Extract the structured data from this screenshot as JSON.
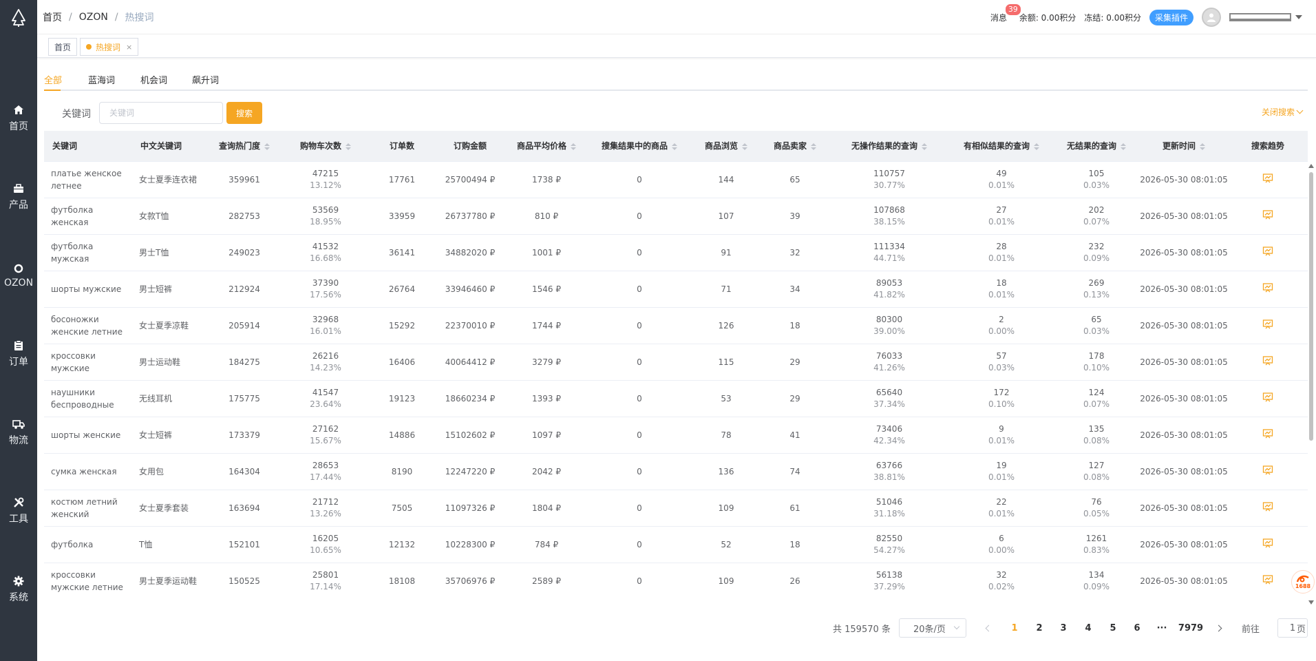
{
  "sidebar": {
    "logo_icon": "tree-logo-icon",
    "items": [
      {
        "label": "首页",
        "icon": "home-icon"
      },
      {
        "label": "产品",
        "icon": "briefcase-icon"
      },
      {
        "label": "OZON",
        "icon": "ozon-ring-icon"
      },
      {
        "label": "订单",
        "icon": "clipboard-icon"
      },
      {
        "label": "物流",
        "icon": "truck-icon"
      },
      {
        "label": "工具",
        "icon": "tools-icon"
      },
      {
        "label": "系统",
        "icon": "gear-icon"
      }
    ]
  },
  "header": {
    "breadcrumb": [
      "首页",
      "OZON",
      "热搜词"
    ],
    "messages_label": "消息",
    "messages_count": "39",
    "balance": "余额: 0.00积分",
    "frozen": "冻结: 0.00积分",
    "plugin_button": "采集插件"
  },
  "tags": [
    {
      "label": "首页"
    },
    {
      "label": "热搜词",
      "close": "×"
    }
  ],
  "tabs": [
    "全部",
    "蓝海词",
    "机会词",
    "飙升词"
  ],
  "search": {
    "label": "关键词",
    "placeholder": "关键词",
    "button": "搜索",
    "close_label": "关闭搜索"
  },
  "table": {
    "columns": [
      "关键词",
      "中文关键词",
      "查询热门度",
      "购物车次数",
      "订单数",
      "订购金额",
      "商品平均价格",
      "搜集结果中的商品",
      "商品浏览",
      "商品卖家",
      "无操作结果的查询",
      "有相似结果的查询",
      "无结果的查询",
      "更新时间",
      "搜索趋势"
    ],
    "rows": [
      {
        "kw": "платье женское летнее",
        "cn": "女士夏季连衣裙",
        "hot": "359961",
        "cart": "47215",
        "cart_pct": "13.12%",
        "orders": "17761",
        "amount": "25700494 ₽",
        "avg": "1738 ₽",
        "results": "0",
        "views": "144",
        "sellers": "65",
        "noop": "110757",
        "noop_pct": "30.77%",
        "similar": "49",
        "similar_pct": "0.01%",
        "none": "105",
        "none_pct": "0.03%",
        "updated": "2026-05-30 08:01:05"
      },
      {
        "kw": "футболка женская",
        "cn": "女款T恤",
        "hot": "282753",
        "cart": "53569",
        "cart_pct": "18.95%",
        "orders": "33959",
        "amount": "26737780 ₽",
        "avg": "810 ₽",
        "results": "0",
        "views": "107",
        "sellers": "39",
        "noop": "107868",
        "noop_pct": "38.15%",
        "similar": "27",
        "similar_pct": "0.01%",
        "none": "202",
        "none_pct": "0.07%",
        "updated": "2026-05-30 08:01:05"
      },
      {
        "kw": "футболка мужская",
        "cn": "男士T恤",
        "hot": "249023",
        "cart": "41532",
        "cart_pct": "16.68%",
        "orders": "36141",
        "amount": "34882020 ₽",
        "avg": "1001 ₽",
        "results": "0",
        "views": "91",
        "sellers": "32",
        "noop": "111334",
        "noop_pct": "44.71%",
        "similar": "28",
        "similar_pct": "0.01%",
        "none": "232",
        "none_pct": "0.09%",
        "updated": "2026-05-30 08:01:05"
      },
      {
        "kw": "шорты мужские",
        "cn": "男士短裤",
        "hot": "212924",
        "cart": "37390",
        "cart_pct": "17.56%",
        "orders": "26764",
        "amount": "33946460 ₽",
        "avg": "1546 ₽",
        "results": "0",
        "views": "71",
        "sellers": "34",
        "noop": "89053",
        "noop_pct": "41.82%",
        "similar": "18",
        "similar_pct": "0.01%",
        "none": "269",
        "none_pct": "0.13%",
        "updated": "2026-05-30 08:01:05"
      },
      {
        "kw": "босоножки женские летние",
        "cn": "女士夏季凉鞋",
        "hot": "205914",
        "cart": "32968",
        "cart_pct": "16.01%",
        "orders": "15292",
        "amount": "22370010 ₽",
        "avg": "1744 ₽",
        "results": "0",
        "views": "126",
        "sellers": "18",
        "noop": "80300",
        "noop_pct": "39.00%",
        "similar": "2",
        "similar_pct": "0.00%",
        "none": "65",
        "none_pct": "0.03%",
        "updated": "2026-05-30 08:01:05"
      },
      {
        "kw": "кроссовки мужские",
        "cn": "男士运动鞋",
        "hot": "184275",
        "cart": "26216",
        "cart_pct": "14.23%",
        "orders": "16406",
        "amount": "40064412 ₽",
        "avg": "3279 ₽",
        "results": "0",
        "views": "115",
        "sellers": "29",
        "noop": "76033",
        "noop_pct": "41.26%",
        "similar": "57",
        "similar_pct": "0.03%",
        "none": "178",
        "none_pct": "0.10%",
        "updated": "2026-05-30 08:01:05"
      },
      {
        "kw": "наушники беспроводные",
        "cn": "无线耳机",
        "hot": "175775",
        "cart": "41547",
        "cart_pct": "23.64%",
        "orders": "19123",
        "amount": "18660234 ₽",
        "avg": "1393 ₽",
        "results": "0",
        "views": "53",
        "sellers": "29",
        "noop": "65640",
        "noop_pct": "37.34%",
        "similar": "172",
        "similar_pct": "0.10%",
        "none": "124",
        "none_pct": "0.07%",
        "updated": "2026-05-30 08:01:05"
      },
      {
        "kw": "шорты женские",
        "cn": "女士短裤",
        "hot": "173379",
        "cart": "27162",
        "cart_pct": "15.67%",
        "orders": "14886",
        "amount": "15102602 ₽",
        "avg": "1097 ₽",
        "results": "0",
        "views": "78",
        "sellers": "41",
        "noop": "73406",
        "noop_pct": "42.34%",
        "similar": "9",
        "similar_pct": "0.01%",
        "none": "135",
        "none_pct": "0.08%",
        "updated": "2026-05-30 08:01:05"
      },
      {
        "kw": "сумка женская",
        "cn": "女用包",
        "hot": "164304",
        "cart": "28653",
        "cart_pct": "17.44%",
        "orders": "8190",
        "amount": "12247220 ₽",
        "avg": "2042 ₽",
        "results": "0",
        "views": "136",
        "sellers": "74",
        "noop": "63766",
        "noop_pct": "38.81%",
        "similar": "19",
        "similar_pct": "0.01%",
        "none": "127",
        "none_pct": "0.08%",
        "updated": "2026-05-30 08:01:05"
      },
      {
        "kw": "костюм летний женский",
        "cn": "女士夏季套装",
        "hot": "163694",
        "cart": "21712",
        "cart_pct": "13.26%",
        "orders": "7505",
        "amount": "11097326 ₽",
        "avg": "1804 ₽",
        "results": "0",
        "views": "109",
        "sellers": "61",
        "noop": "51046",
        "noop_pct": "31.18%",
        "similar": "22",
        "similar_pct": "0.01%",
        "none": "76",
        "none_pct": "0.05%",
        "updated": "2026-05-30 08:01:05"
      },
      {
        "kw": "футболка",
        "cn": "T恤",
        "hot": "152101",
        "cart": "16205",
        "cart_pct": "10.65%",
        "orders": "12132",
        "amount": "10228300 ₽",
        "avg": "784 ₽",
        "results": "0",
        "views": "52",
        "sellers": "18",
        "noop": "82550",
        "noop_pct": "54.27%",
        "similar": "6",
        "similar_pct": "0.00%",
        "none": "1261",
        "none_pct": "0.83%",
        "updated": "2026-05-30 08:01:05"
      },
      {
        "kw": "кроссовки мужские летние",
        "cn": "男士夏季运动鞋",
        "hot": "150525",
        "cart": "25801",
        "cart_pct": "17.14%",
        "orders": "18108",
        "amount": "35706976 ₽",
        "avg": "2589 ₽",
        "results": "0",
        "views": "109",
        "sellers": "26",
        "noop": "56138",
        "noop_pct": "37.29%",
        "similar": "32",
        "similar_pct": "0.02%",
        "none": "134",
        "none_pct": "0.09%",
        "updated": "2026-05-30 08:01:05"
      }
    ]
  },
  "pagination": {
    "total": "共 159570 条",
    "page_size": "20条/页",
    "pages": [
      "1",
      "2",
      "3",
      "4",
      "5",
      "6"
    ],
    "ellipsis": "···",
    "last_page": "7979",
    "goto_label": "前往",
    "goto_value": "1",
    "goto_suffix": "页"
  },
  "float_badge": "1688",
  "colors": {
    "sidebar_bg": "#2f3640",
    "accent": "#f5a623",
    "plugin_blue": "#409eff",
    "badge_red": "#f56c6c"
  }
}
